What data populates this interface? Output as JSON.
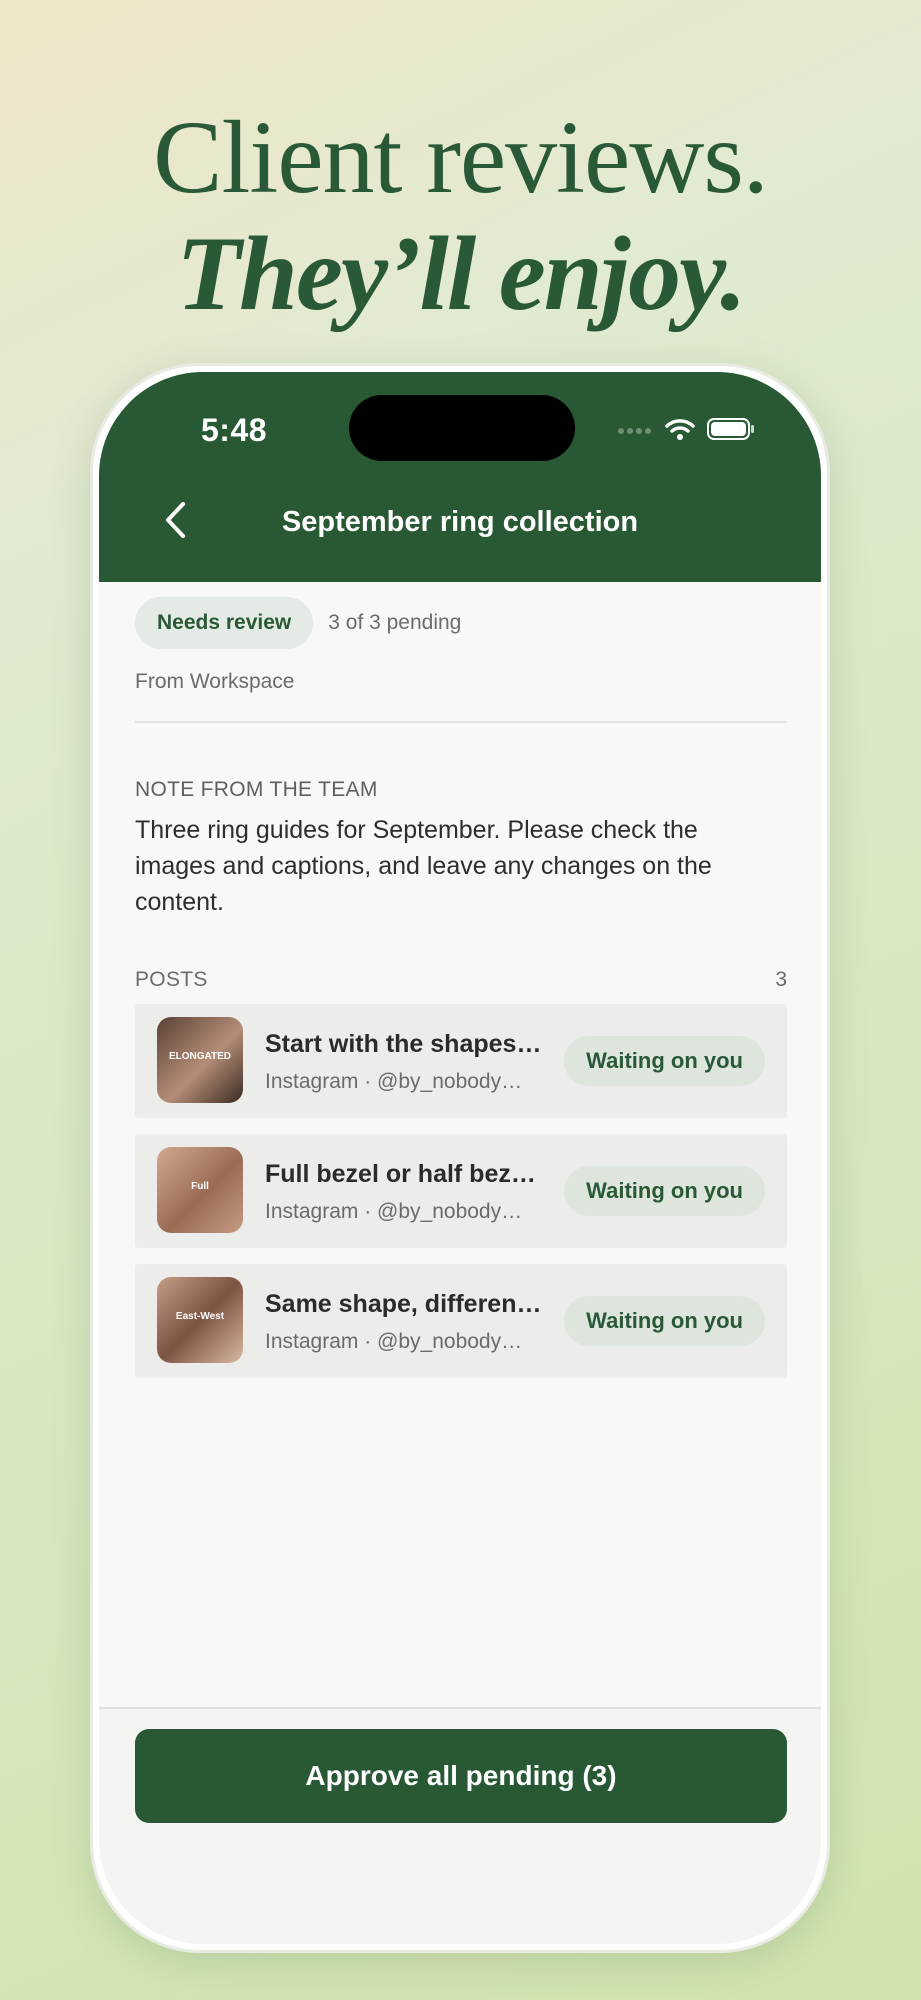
{
  "headline": {
    "line1": "Client reviews.",
    "line2": "They’ll enjoy."
  },
  "status_bar": {
    "time": "5:48"
  },
  "header": {
    "title": "September ring collection",
    "back_icon": "chevron-left-icon"
  },
  "review": {
    "status_pill": "Needs review",
    "pending_text": "3 of 3 pending",
    "from_text": "From Workspace"
  },
  "note": {
    "label": "NOTE FROM THE TEAM",
    "text": "Three ring guides for September. Please check the images and captions, and leave any changes on the content."
  },
  "posts": {
    "label": "POSTS",
    "count": "3",
    "items": [
      {
        "title": "Start with the shapes…",
        "subtitle": "Instagram · @by_nobody…",
        "badge": "Waiting on you",
        "thumb_text": "ELONGATED",
        "thumb_color": "#8a6a55"
      },
      {
        "title": "Full bezel or half beze…",
        "subtitle": "Instagram · @by_nobody…",
        "badge": "Waiting on you",
        "thumb_text": "Full",
        "thumb_color": "#b98b74"
      },
      {
        "title": "Same shape, differen…",
        "subtitle": "Instagram · @by_nobody…",
        "badge": "Waiting on you",
        "thumb_text": "East-West",
        "thumb_color": "#a17a63"
      }
    ]
  },
  "footer": {
    "approve_label": "Approve all pending (3)"
  },
  "colors": {
    "brand_green": "#285834",
    "badge_bg": "#dde5dd"
  }
}
